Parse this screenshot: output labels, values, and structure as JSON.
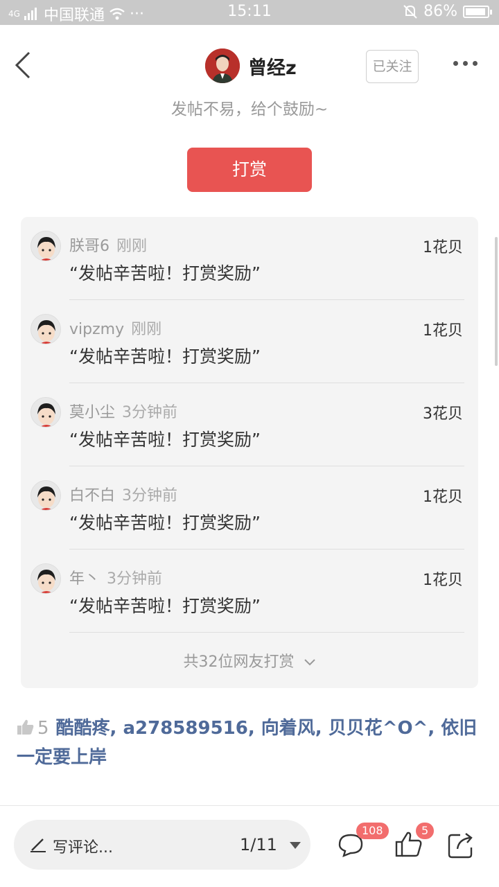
{
  "status_bar": {
    "network_type": "4G",
    "carrier": "中国联通",
    "dots": "···",
    "time": "15:11",
    "battery": "86%"
  },
  "header": {
    "author_name": "曾经z",
    "follow_label": "已关注",
    "encourage_text": "发帖不易，给个鼓励~"
  },
  "reward_button": "打赏",
  "rewards": [
    {
      "name": "朕哥6",
      "time": "刚刚",
      "amount": "1花贝",
      "message": "“发帖辛苦啦！打赏奖励”"
    },
    {
      "name": "vipzmy",
      "time": "刚刚",
      "amount": "1花贝",
      "message": "“发帖辛苦啦！打赏奖励”"
    },
    {
      "name": "莫小尘",
      "time": "3分钟前",
      "amount": "3花贝",
      "message": "“发帖辛苦啦！打赏奖励”"
    },
    {
      "name": "白不白",
      "time": "3分钟前",
      "amount": "1花贝",
      "message": "“发帖辛苦啦！打赏奖励”"
    },
    {
      "name": "年丶",
      "time": "3分钟前",
      "amount": "1花贝",
      "message": "“发帖辛苦啦！打赏奖励”"
    }
  ],
  "reward_total": "共32位网友打赏",
  "likes": {
    "count": "5",
    "names": "酷酷疼, a278589516, 向着风, 贝贝花^O^, 依旧一定要上岸"
  },
  "bottom_bar": {
    "comment_placeholder": "写评论...",
    "page_indicator": "1/11",
    "comment_badge": "108",
    "like_badge": "5"
  },
  "colors": {
    "accent": "#e85452",
    "link": "#4f6a99",
    "badge": "#f26d6d"
  }
}
